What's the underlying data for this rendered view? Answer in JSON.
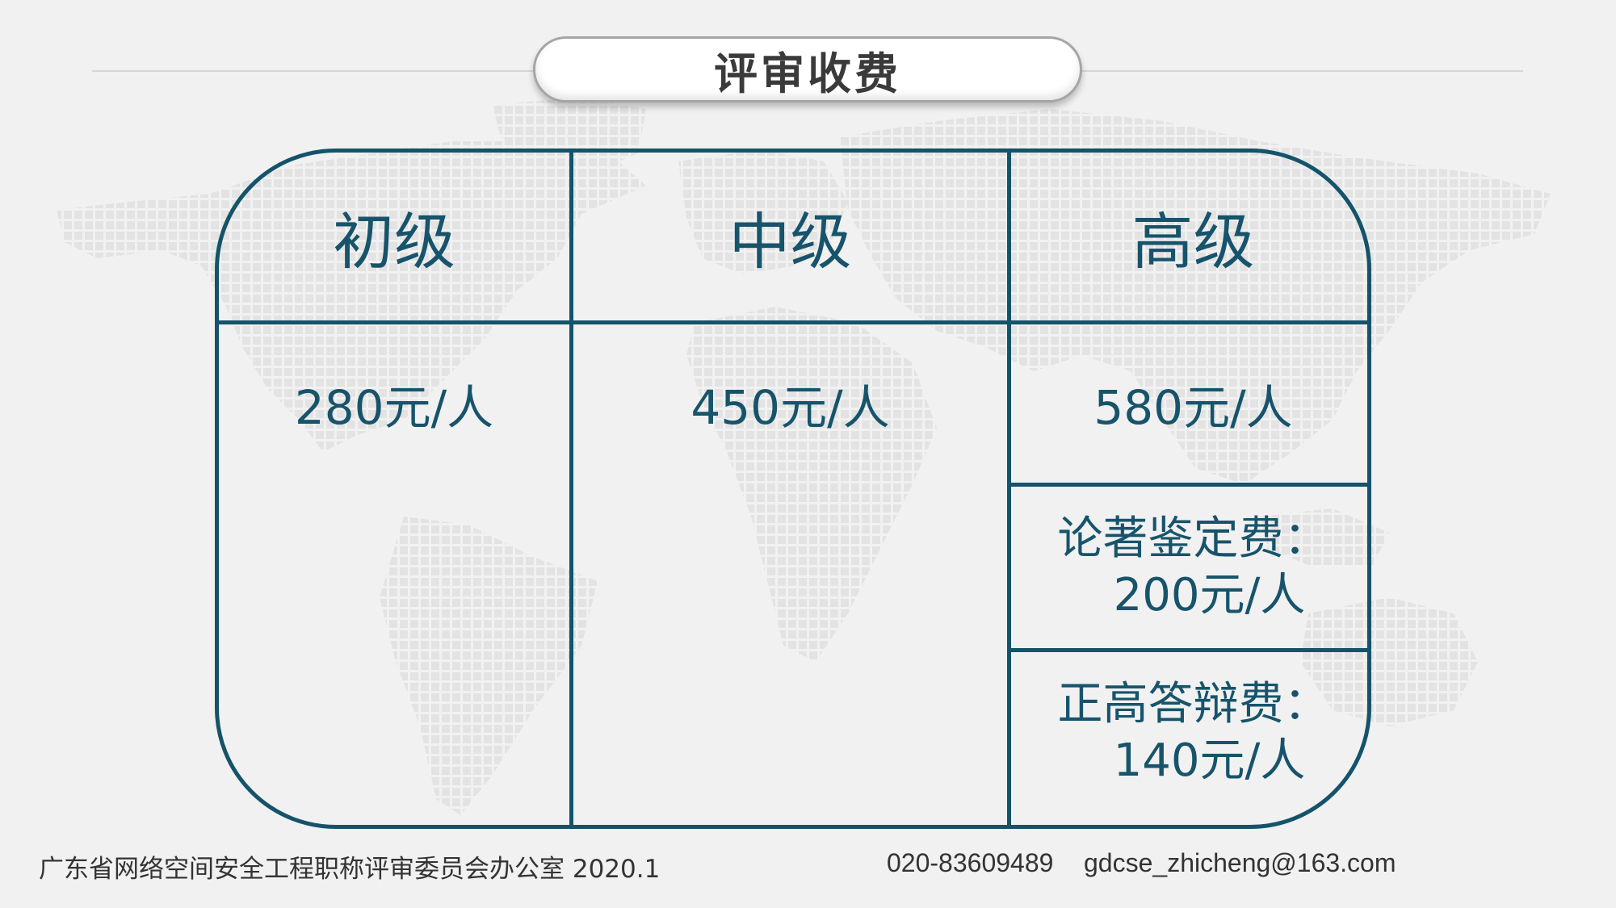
{
  "title": "评审收费",
  "colors": {
    "accent": "#14536a",
    "text": "#17546b",
    "background": "#f1f1f1",
    "map_dots": "#e4e4e4"
  },
  "decor": {
    "background_icon": "world-map-dots-icon"
  },
  "table": {
    "columns": [
      {
        "header": "初级",
        "price": "280元/人"
      },
      {
        "header": "中级",
        "price": "450元/人"
      },
      {
        "header": "高级",
        "price": "580元/人"
      }
    ],
    "extras": [
      {
        "label": "论著鉴定费：",
        "value": "200元/人"
      },
      {
        "label": "正高答辩费：",
        "value": "140元/人"
      }
    ]
  },
  "footer": {
    "organization": "广东省网络空间安全工程职称评审委员会办公室 2020.1",
    "phone": "020-83609489",
    "email": "gdcse_zhicheng@163.com"
  }
}
